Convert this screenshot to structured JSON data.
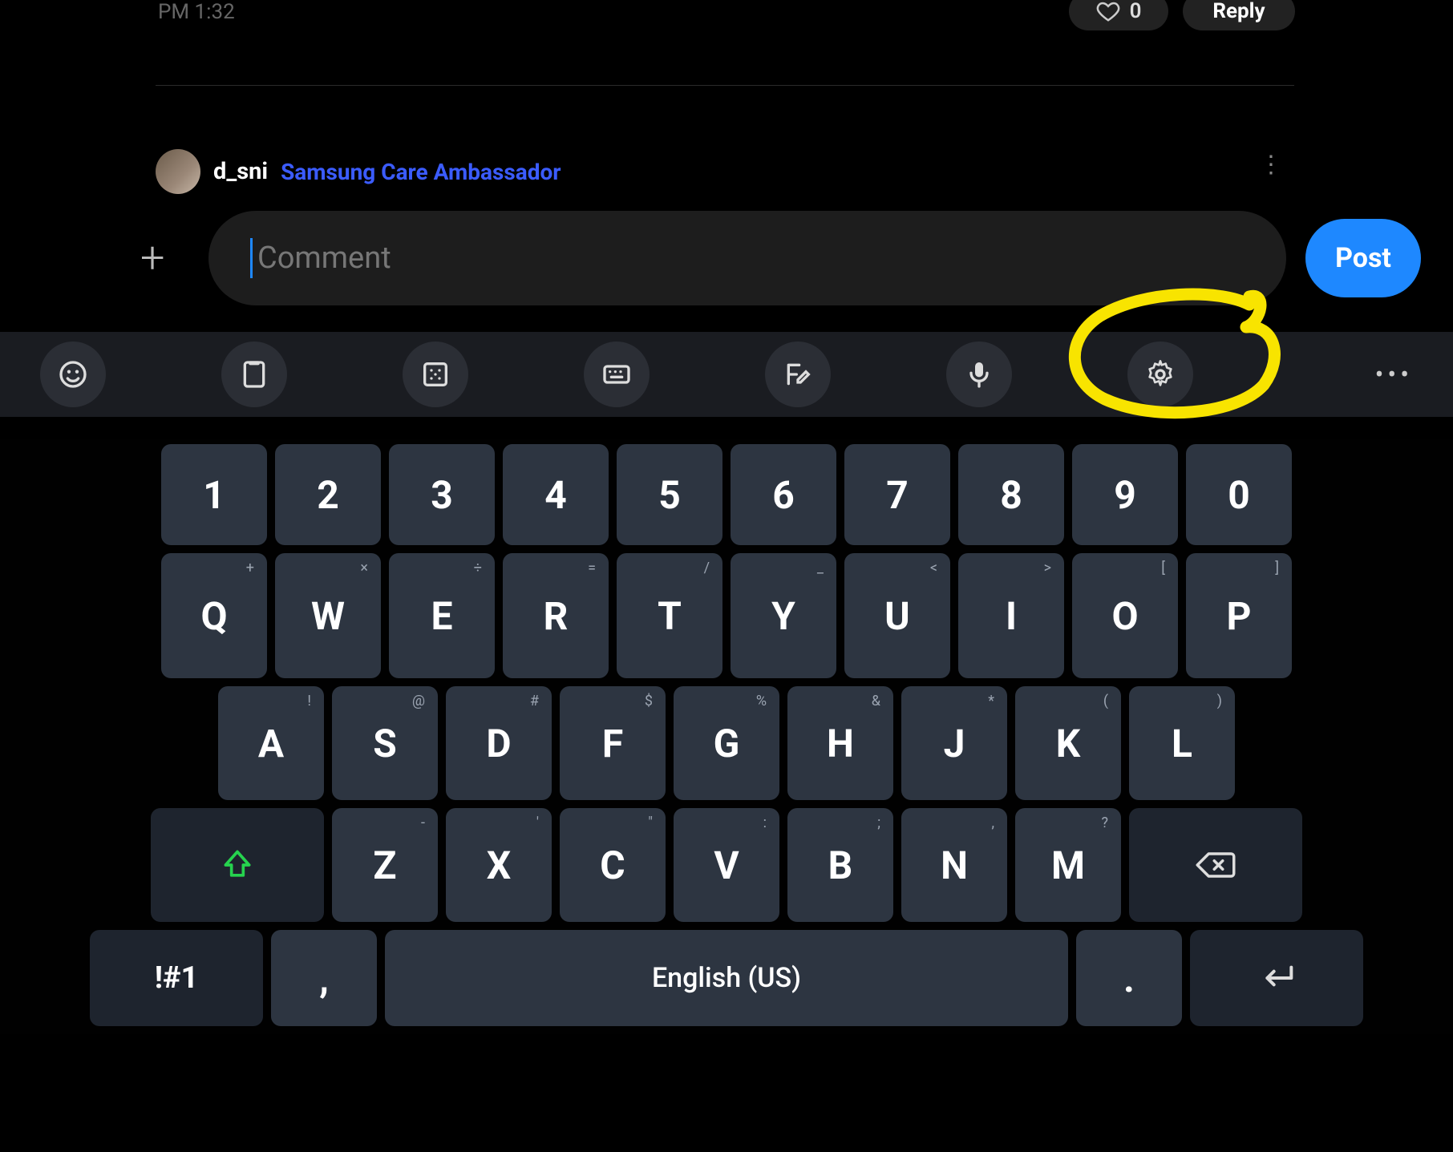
{
  "meta": {
    "timestamp": "PM 1:32",
    "like_count": "0",
    "reply_label": "Reply"
  },
  "next_comment": {
    "username": "d_sni",
    "badge": "Samsung Care Ambassador"
  },
  "compose": {
    "placeholder": "Comment",
    "post_label": "Post"
  },
  "toolbar": {
    "more": "•••"
  },
  "keyboard": {
    "row1": [
      "1",
      "2",
      "3",
      "4",
      "5",
      "6",
      "7",
      "8",
      "9",
      "0"
    ],
    "row2": [
      {
        "m": "Q",
        "s": "+"
      },
      {
        "m": "W",
        "s": "×"
      },
      {
        "m": "E",
        "s": "÷"
      },
      {
        "m": "R",
        "s": "="
      },
      {
        "m": "T",
        "s": "/"
      },
      {
        "m": "Y",
        "s": "_"
      },
      {
        "m": "U",
        "s": "<"
      },
      {
        "m": "I",
        "s": ">"
      },
      {
        "m": "O",
        "s": "["
      },
      {
        "m": "P",
        "s": "]"
      }
    ],
    "row3": [
      {
        "m": "A",
        "s": "!"
      },
      {
        "m": "S",
        "s": "@"
      },
      {
        "m": "D",
        "s": "#"
      },
      {
        "m": "F",
        "s": "$"
      },
      {
        "m": "G",
        "s": "%"
      },
      {
        "m": "H",
        "s": "&"
      },
      {
        "m": "J",
        "s": "*"
      },
      {
        "m": "K",
        "s": "("
      },
      {
        "m": "L",
        "s": ")"
      }
    ],
    "row4": [
      {
        "m": "Z",
        "s": "-"
      },
      {
        "m": "X",
        "s": "'"
      },
      {
        "m": "C",
        "s": "\""
      },
      {
        "m": "V",
        "s": ":"
      },
      {
        "m": "B",
        "s": ";"
      },
      {
        "m": "N",
        "s": ","
      },
      {
        "m": "M",
        "s": "?"
      }
    ],
    "row5": {
      "sym": "!#1",
      "comma": ",",
      "space": "English (US)",
      "period": "."
    }
  }
}
